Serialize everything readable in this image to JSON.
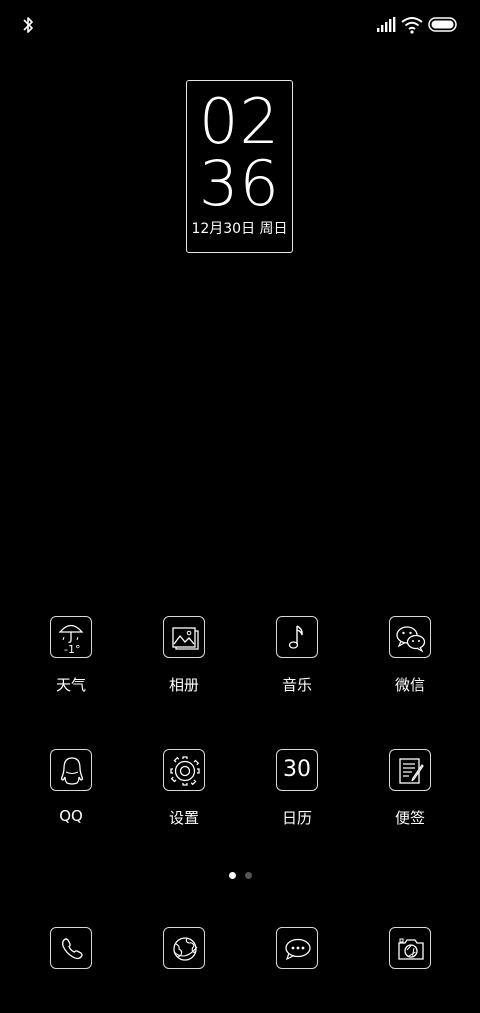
{
  "status_bar": {
    "bluetooth_icon": "bluetooth-icon",
    "signal_icon": "signal-icon",
    "wifi_icon": "wifi-icon",
    "battery_icon": "battery-icon"
  },
  "clock": {
    "hours": "02",
    "minutes": "36",
    "date": "12月30日 周日"
  },
  "apps": {
    "row1": [
      {
        "label": "天气",
        "icon": "weather-icon",
        "temp": "-1°"
      },
      {
        "label": "相册",
        "icon": "gallery-icon"
      },
      {
        "label": "音乐",
        "icon": "music-icon"
      },
      {
        "label": "微信",
        "icon": "wechat-icon"
      }
    ],
    "row2": [
      {
        "label": "QQ",
        "icon": "qq-icon"
      },
      {
        "label": "设置",
        "icon": "settings-icon"
      },
      {
        "label": "日历",
        "icon": "calendar-icon",
        "day": "30"
      },
      {
        "label": "便签",
        "icon": "notes-icon"
      }
    ]
  },
  "page_indicator": {
    "count": 2,
    "active": 0
  },
  "dock": [
    {
      "icon": "phone-icon"
    },
    {
      "icon": "browser-icon"
    },
    {
      "icon": "messages-icon"
    },
    {
      "icon": "camera-icon"
    }
  ]
}
